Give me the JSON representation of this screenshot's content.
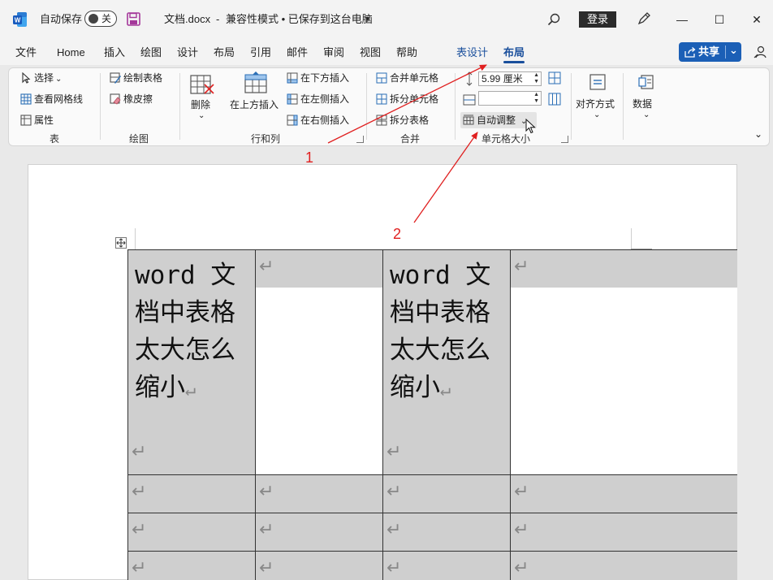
{
  "title_bar": {
    "app_icon": "word-logo-icon",
    "autosave_label": "自动保存",
    "autosave_state": "关",
    "save_icon": "save-icon",
    "doc_title": "文档.docx",
    "sep": "-",
    "compat_status": "兼容性模式 • 已保存到这台电脑",
    "search_icon": "search-icon",
    "login_label": "登录",
    "pen_icon": "pen-icon",
    "min_glyph": "—",
    "max_glyph": "☐",
    "close_glyph": "✕"
  },
  "tabs": {
    "file": "文件",
    "home": "Home",
    "insert": "插入",
    "draw": "绘图",
    "design": "设计",
    "layout": "布局",
    "references": "引用",
    "mailings": "邮件",
    "review": "审阅",
    "view": "视图",
    "help": "帮助",
    "table_design": "表设计",
    "table_layout": "布局",
    "share_label": "共享",
    "share_chevron": "⌄"
  },
  "ribbon": {
    "table_group": {
      "select": "选择",
      "select_chevron": "⌄",
      "view_gridlines": "查看网格线",
      "properties": "属性",
      "label": "表"
    },
    "draw_group": {
      "draw_table": "绘制表格",
      "eraser": "橡皮擦",
      "label": "绘图"
    },
    "rows_cols_group": {
      "delete": "删除",
      "delete_chevron": "⌄",
      "insert_above": "在上方插入",
      "insert_below": "在下方插入",
      "insert_left": "在左侧插入",
      "insert_right": "在右侧插入",
      "label": "行和列"
    },
    "merge_group": {
      "merge_cells": "合并单元格",
      "split_cells": "拆分单元格",
      "split_table": "拆分表格",
      "label": "合并"
    },
    "cell_size_group": {
      "height_value": "5.99 厘米",
      "width_value": "",
      "autofit": "自动调整",
      "autofit_chevron": "⌄",
      "label": "单元格大小"
    },
    "align_group": {
      "label": "对齐方式",
      "chevron": "⌄"
    },
    "data_group": {
      "label": "数据",
      "chevron": "⌄"
    },
    "collapse_chevron": "⌄"
  },
  "document": {
    "cell_a1_text": "word 文档中表格太大怎么缩小",
    "cell_c1_text": "word 文档中表格太大怎么缩小",
    "para_mark": "↵"
  },
  "annotations": {
    "label_1": "1",
    "label_2": "2",
    "color": "#e02020"
  }
}
